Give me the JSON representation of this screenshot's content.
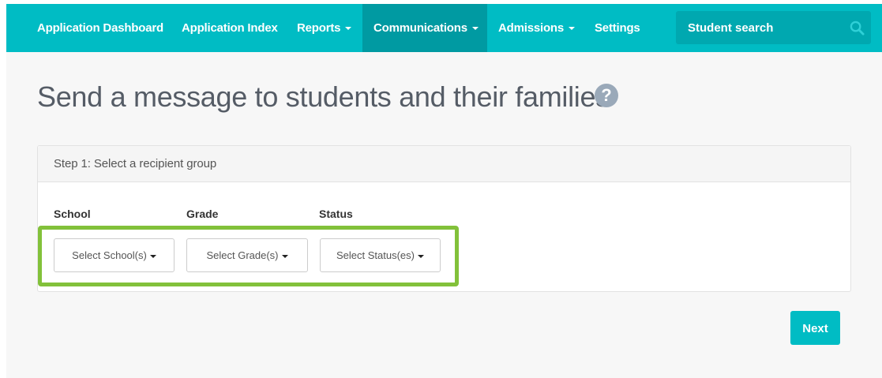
{
  "navbar": {
    "items": [
      {
        "label": "Application Dashboard",
        "has_dropdown": false
      },
      {
        "label": "Application Index",
        "has_dropdown": false
      },
      {
        "label": "Reports",
        "has_dropdown": true
      },
      {
        "label": "Communications",
        "has_dropdown": true,
        "active": true
      },
      {
        "label": "Admissions",
        "has_dropdown": true
      },
      {
        "label": "Settings",
        "has_dropdown": false
      }
    ],
    "search": {
      "placeholder": "Student search",
      "icon": "search-icon"
    }
  },
  "page": {
    "title": "Send a message to students and their families",
    "help_icon": "question-circle-icon",
    "help_glyph": "?"
  },
  "step1": {
    "heading": "Step 1: Select a recipient group",
    "school": {
      "label": "School",
      "button": "Select School(s)"
    },
    "grade": {
      "label": "Grade",
      "button": "Select Grade(s)"
    },
    "status": {
      "label": "Status",
      "button": "Select Status(es)"
    }
  },
  "actions": {
    "next_label": "Next"
  },
  "colors": {
    "navbar": "#00bcc4",
    "navbar_active": "#009aa2",
    "search_bg": "#00a8b0",
    "highlight": "#82c13a",
    "primary_button": "#00bcc4",
    "help_icon": "#9aa9b9"
  }
}
